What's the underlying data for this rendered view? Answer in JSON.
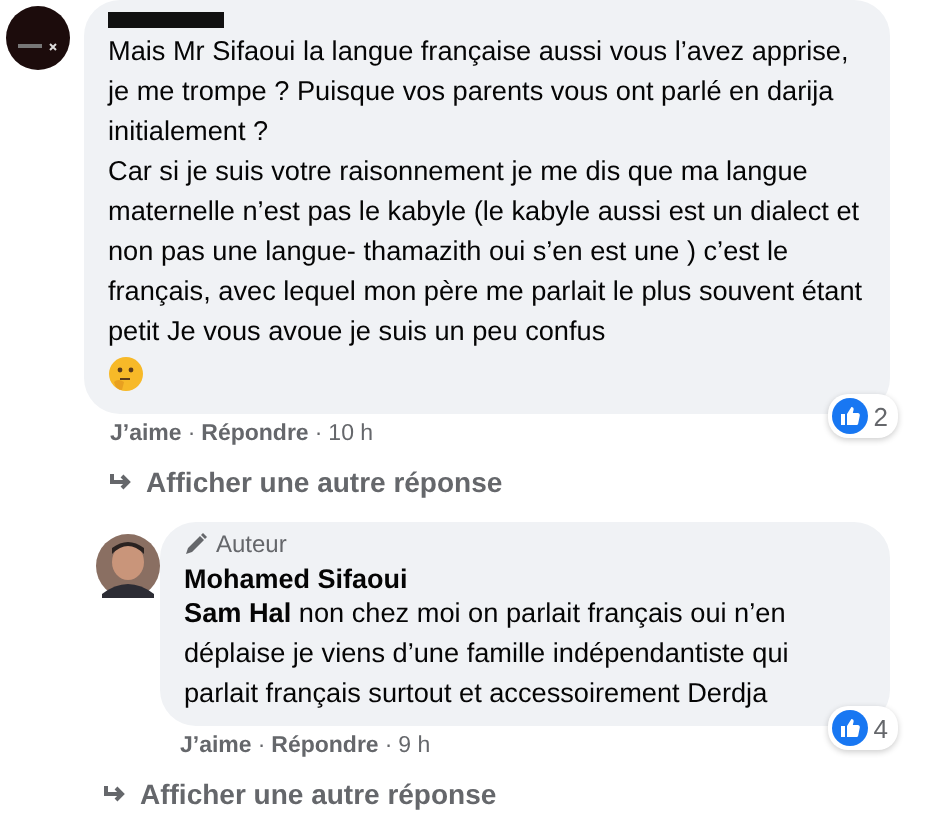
{
  "comments": [
    {
      "author_redacted": true,
      "paragraphs": [
        "Mais Mr Sifaoui la langue française aussi vous l’avez apprise, je me trompe ? Puisque vos parents vous ont parlé en darija initialement ?",
        "Car si je suis votre raisonnement je me dis que ma langue maternelle n’est pas le kabyle (le kabyle aussi est un dialect et non pas une langue- thamazith oui s’en est une ) c’est le français, avec lequel mon père me parlait le plus souvent étant petit Je vous avoue je suis un peu confus"
      ],
      "emoji": true,
      "reactions": "2",
      "actions": [
        "J’aime",
        "·",
        "Répondre",
        "·",
        "10 h"
      ],
      "more_replies": "Afficher une autre réponse",
      "indent": false
    },
    {
      "author": "Mohamed Sifaoui",
      "author_redacted": false,
      "author_badge": "Auteur",
      "paragraphs": [
        "**Sam Hal** non chez moi on parlait français oui n’en déplaise je viens d’une famille indépendantiste qui parlait français surtout et accessoirement Derdja"
      ],
      "emoji": false,
      "reactions": "4",
      "actions": [
        "J’aime",
        "·",
        "Répondre",
        "·",
        "9 h"
      ],
      "more_replies": "Afficher une autre réponse",
      "indent": true
    }
  ]
}
